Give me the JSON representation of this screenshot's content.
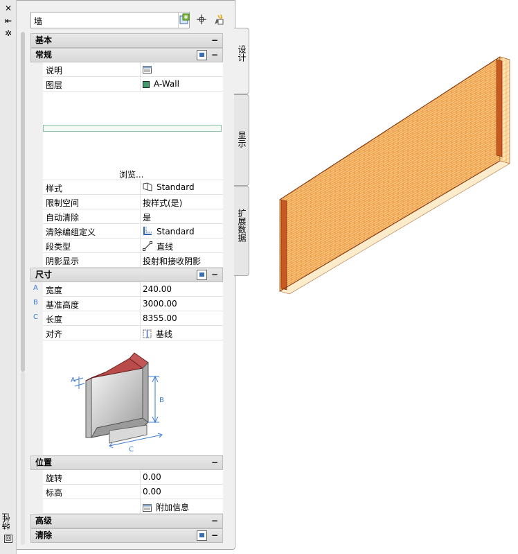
{
  "strip": {
    "close_glyph": "✕",
    "pin_glyph": "⇤",
    "settings_glyph": "✲",
    "title": "特性",
    "icon_glyph": "回"
  },
  "selector": {
    "value": "墙"
  },
  "sections": {
    "basic": {
      "title": "基本",
      "collapse": "−"
    },
    "general": {
      "title": "常规",
      "collapse": "−",
      "description_label": "说明",
      "layer_label": "图层",
      "layer_value": "A-Wall",
      "layer_color": "#3d9b6c",
      "browse": "浏览...",
      "style_label": "样式",
      "style_value": "Standard",
      "bound_label": "限制空间",
      "bound_value": "按样式(是)",
      "cleanup_label": "自动清除",
      "cleanup_value": "是",
      "cleanup_group_label": "清除编组定义",
      "cleanup_group_value": "Standard",
      "segment_label": "段类型",
      "segment_value": "直线",
      "shadow_label": "阴影显示",
      "shadow_value": "投射和接收阴影"
    },
    "dimensions": {
      "title": "尺寸",
      "collapse": "−",
      "width_letter": "A",
      "width_label": "宽度",
      "width_value": "240.00",
      "height_letter": "B",
      "height_label": "基准高度",
      "height_value": "3000.00",
      "length_letter": "C",
      "length_label": "长度",
      "length_value": "8355.00",
      "justify_label": "对齐",
      "justify_value": "基线",
      "diagram_a": "A",
      "diagram_b": "B",
      "diagram_c": "C"
    },
    "location": {
      "title": "位置",
      "collapse": "−",
      "rotation_label": "旋转",
      "rotation_value": "0.00",
      "elevation_label": "标高",
      "elevation_value": "0.00",
      "extra_info": "附加信息"
    },
    "advanced": {
      "title": "高级",
      "collapse": "−"
    },
    "clean": {
      "title": "清除",
      "collapse": "−"
    }
  },
  "tabs": {
    "design": "设计",
    "display": "显示",
    "extended": "扩展数据"
  },
  "colors": {
    "brick": "#e8892a",
    "brick_dark": "#9c4b15",
    "panel_bg": "#f0f0f0",
    "accent": "#3a7bd5"
  }
}
